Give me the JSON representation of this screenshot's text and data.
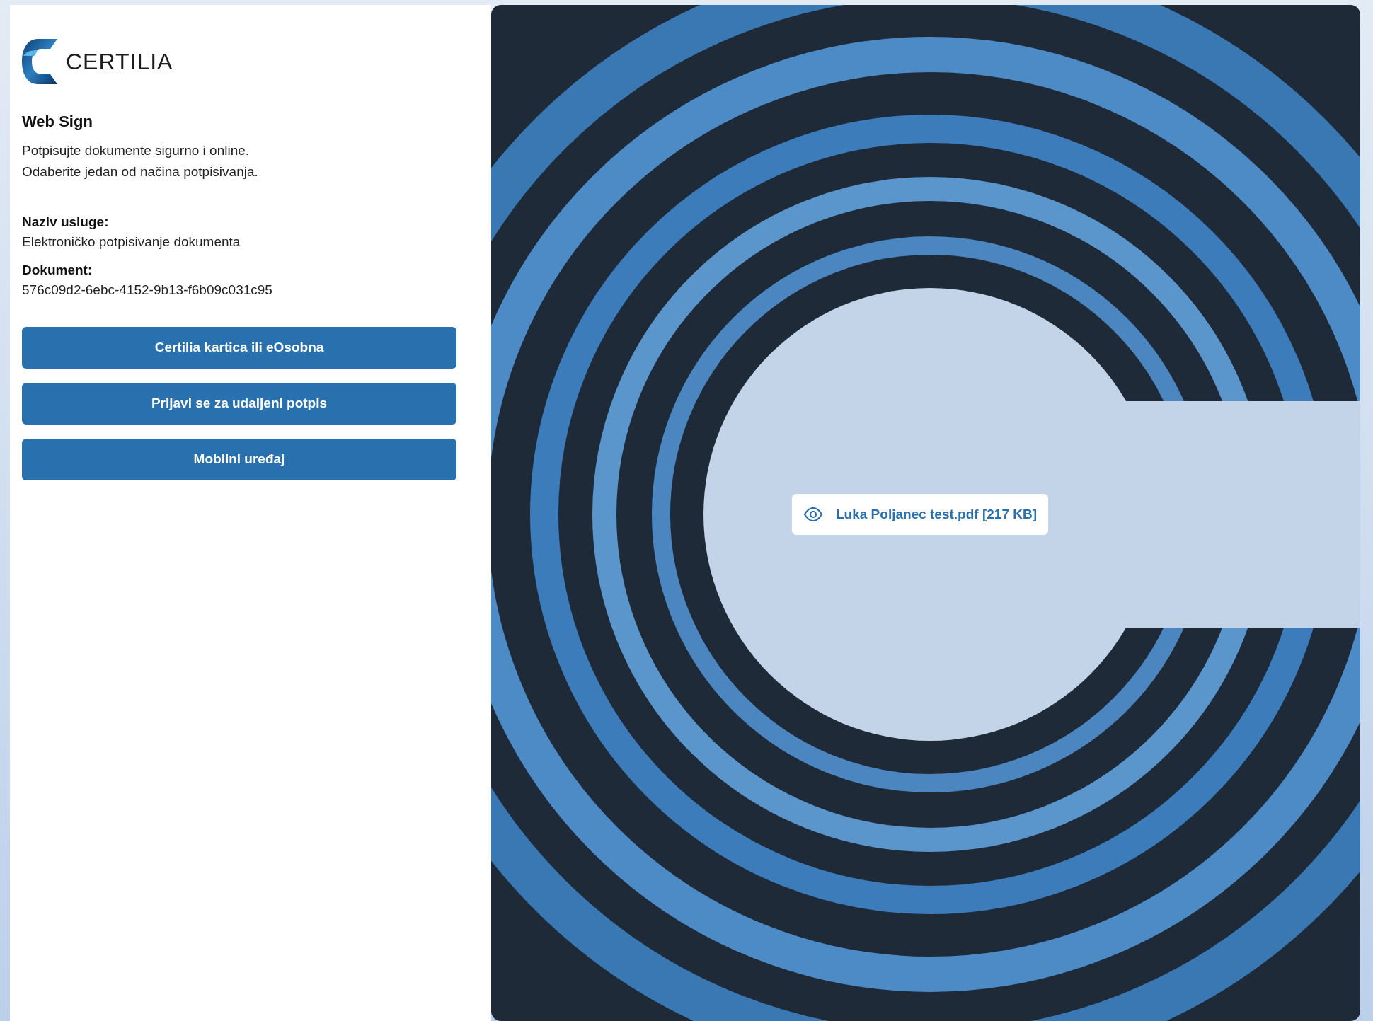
{
  "brand": {
    "name": "CERTILIA"
  },
  "title": "Web Sign",
  "description": [
    "Potpisujte dokumente sigurno i online.",
    "Odaberite jedan od načina potpisivanja."
  ],
  "details": [
    {
      "label": "Naziv usluge:",
      "value": "Elektroničko potpisivanje dokumenta"
    },
    {
      "label": "Dokument:",
      "value": "576c09d2-6ebc-4152-9b13-f6b09c031c95"
    }
  ],
  "buttons": [
    "Certilia kartica ili eOsobna",
    "Prijavi se za udaljeni potpis",
    "Mobilni uređaj"
  ],
  "file_link": "Luka Poljanec test.pdf [217 KB]"
}
